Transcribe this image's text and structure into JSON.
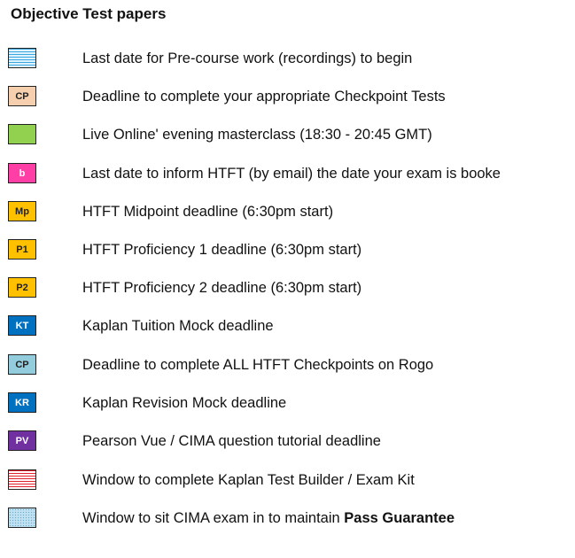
{
  "title": "Objective Test papers",
  "items": [
    {
      "code": "",
      "label": "Last date for Pre-course work (recordings) to begin",
      "swatch": "blue-horizontal-lines",
      "color": "#3aa7df"
    },
    {
      "code": "CP",
      "label": "Deadline to complete your appropriate Checkpoint Tests",
      "swatch": "peach",
      "color": "#f6cfae"
    },
    {
      "code": "",
      "label": "Live Online' evening masterclass (18:30 - 20:45 GMT)",
      "swatch": "green",
      "color": "#92d050"
    },
    {
      "code": "b",
      "label": "Last date to inform HTFT (by email) the date your exam is booke",
      "swatch": "pink",
      "color": "#ff3fa5"
    },
    {
      "code": "Mp",
      "label": "HTFT Midpoint deadline (6:30pm start)",
      "swatch": "amber",
      "color": "#ffc000"
    },
    {
      "code": "P1",
      "label": "HTFT Proficiency 1 deadline (6:30pm start)",
      "swatch": "amber",
      "color": "#ffc000"
    },
    {
      "code": "P2",
      "label": "HTFT Proficiency 2 deadline (6:30pm start)",
      "swatch": "amber",
      "color": "#ffc000"
    },
    {
      "code": "KT",
      "label": "Kaplan Tuition Mock deadline",
      "swatch": "blue",
      "color": "#0070c0"
    },
    {
      "code": "CP",
      "label": "Deadline to complete ALL HTFT Checkpoints on Rogo",
      "swatch": "light-blue",
      "color": "#93cddd"
    },
    {
      "code": "KR",
      "label": "Kaplan Revision Mock deadline",
      "swatch": "blue",
      "color": "#0070c0"
    },
    {
      "code": "PV",
      "label": "Pearson Vue / CIMA question tutorial deadline",
      "swatch": "purple",
      "color": "#7030a0"
    },
    {
      "code": "",
      "label": "Window to complete Kaplan Test Builder / Exam Kit",
      "swatch": "red-horizontal-lines",
      "color": "#e0202a"
    },
    {
      "code": "",
      "label": "Window to sit CIMA exam in to maintain ",
      "label_bold": "Pass Guarantee",
      "swatch": "blue-dotted",
      "color": "#bfe1f2"
    }
  ]
}
